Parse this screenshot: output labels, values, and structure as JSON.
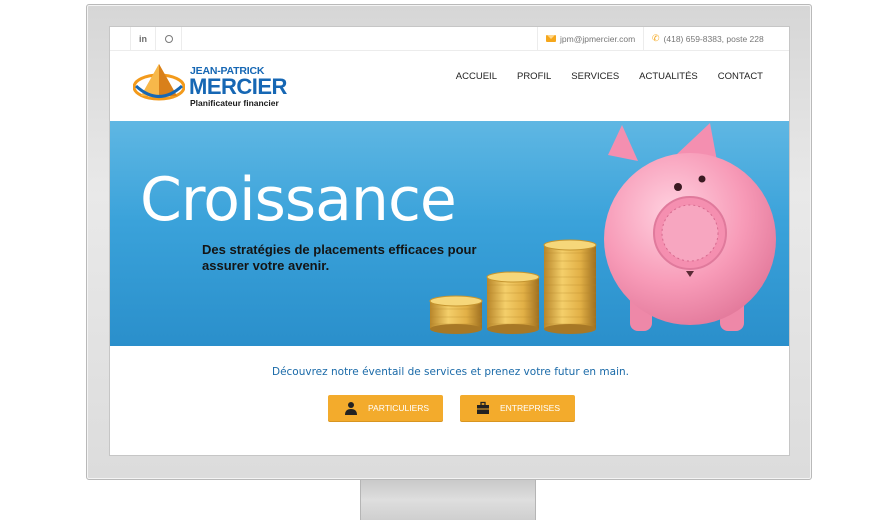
{
  "topbar": {
    "social": [
      {
        "label": "in",
        "icon": "linkedin-icon"
      },
      {
        "label": "",
        "icon": "skype-icon"
      }
    ],
    "email": "jpm@jpmercier.com",
    "phone": "(418) 659-8383, poste 228"
  },
  "logo": {
    "line1": "JEAN-PATRICK",
    "line2": "MERCIER",
    "line3": "Planificateur financier"
  },
  "nav": {
    "items": [
      "ACCUEIL",
      "PROFIL",
      "SERVICES",
      "ACTUALITÉS",
      "CONTACT"
    ]
  },
  "hero": {
    "title": "Croissance",
    "subtitle": "Des stratégies de placements efficaces pour assurer votre avenir."
  },
  "tagline": "Découvrez notre éventail de services et prenez votre futur en main.",
  "buttons": {
    "particuliers": "PARTICULIERS",
    "entreprises": "ENTREPRISES"
  },
  "colors": {
    "brand_blue": "#1667b4",
    "accent_orange": "#f3ab2c",
    "hero_blue": "#3aa2da",
    "tagline_blue": "#1a6aa8"
  }
}
